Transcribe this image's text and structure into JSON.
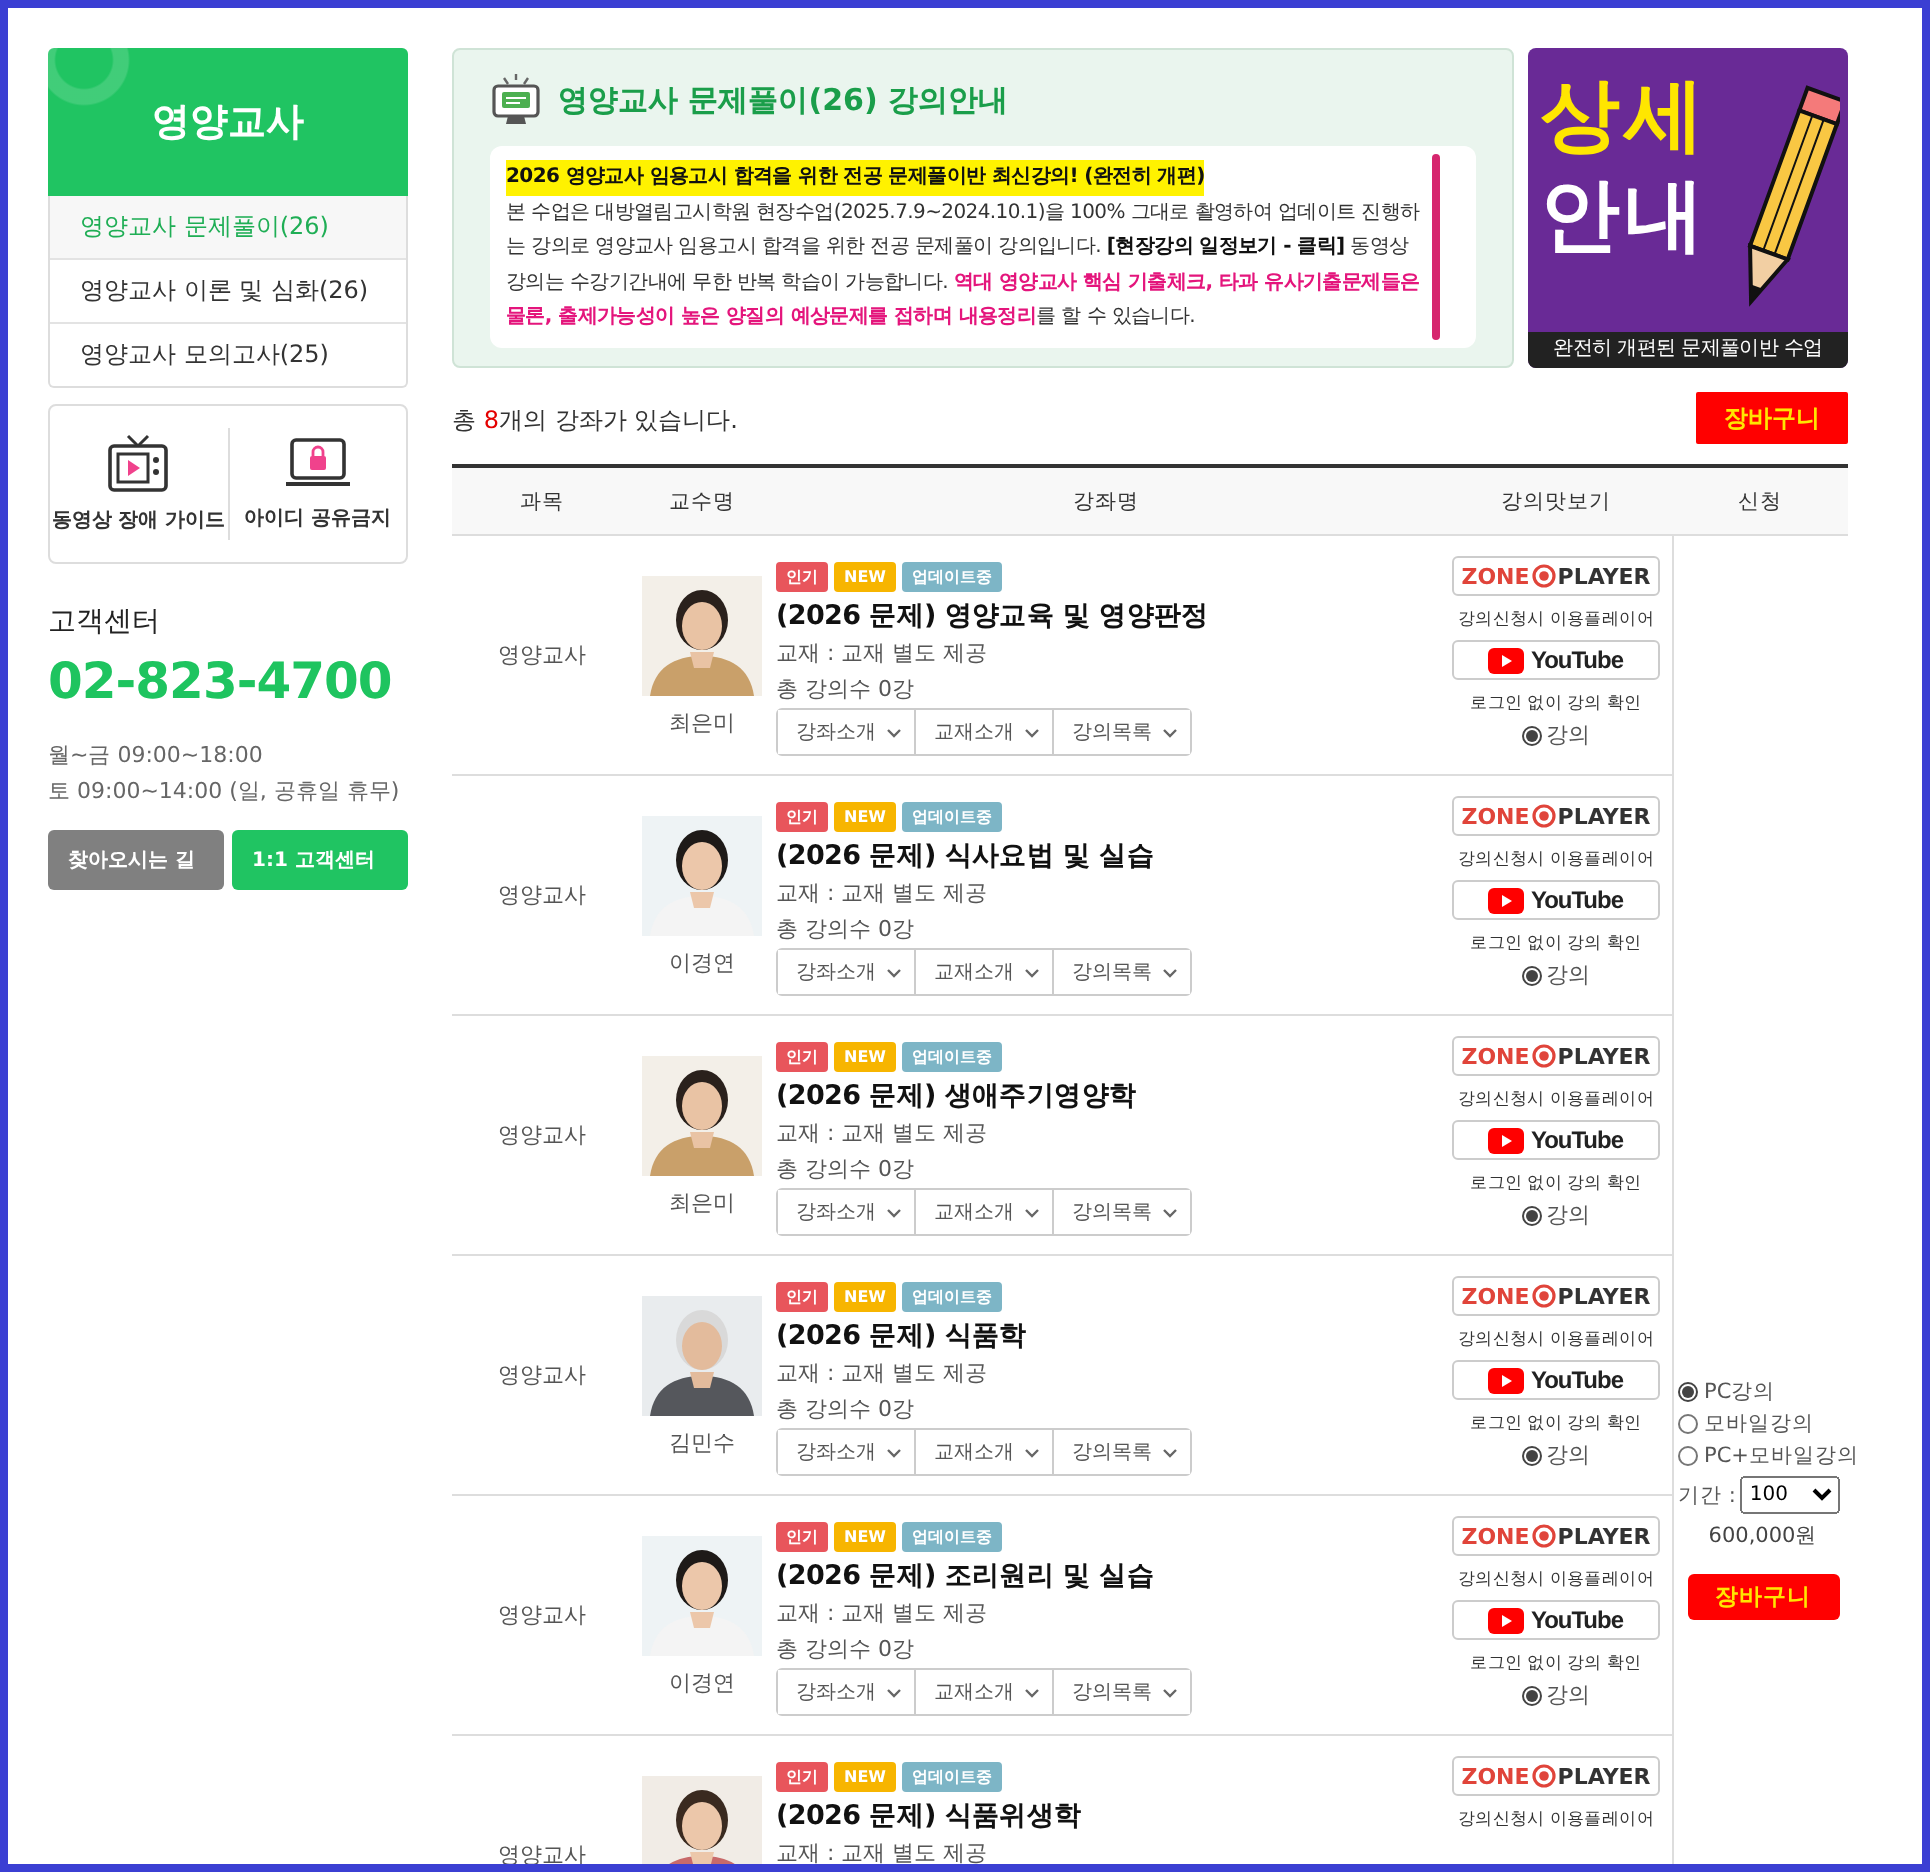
{
  "sidebar": {
    "title": "영양교사",
    "menu": [
      {
        "label": "영양교사 문제풀이(26)",
        "selected": true
      },
      {
        "label": "영양교사 이론 및 심화(26)",
        "selected": false
      },
      {
        "label": "영양교사 모의고사(25)",
        "selected": false
      }
    ],
    "tiles": [
      {
        "kind": "tv",
        "label": "동영상 장애 가이드"
      },
      {
        "kind": "laptop",
        "label": "아이디 공유금지"
      }
    ],
    "support": {
      "title": "고객센터",
      "phone": "02-823-4700",
      "hours": [
        "월~금 09:00~18:00",
        "토 09:00~14:00 (일, 공휴일 휴무)"
      ],
      "buttons": [
        {
          "label": "찾아오시는 길",
          "kind": "secondary"
        },
        {
          "label": "1:1 고객센터",
          "kind": "primary"
        }
      ]
    }
  },
  "info": {
    "title": "영양교사 문제풀이(26) 강의안내",
    "headline": "2026 영양교사 임용고시 합격을 위한 전공 문제풀이반 최신강의! (완전히 개편)",
    "body": [
      {
        "kind": "plain",
        "text": "본 수업은 대방열림고시학원 현장수업(2025.7.9~2024.10.1)을 100% 그대로 촬영하여 업데이트 진행하는 강의로 영양교사 임용고시 합격을 위한 전공 문제풀이 강의입니다. "
      },
      {
        "kind": "link",
        "text": "[현장강의 일정보기 - 클릭]"
      },
      {
        "kind": "plain",
        "text": " 동영상 강의는 수강기간내에 무한 반복 학습이 가능합니다. "
      },
      {
        "kind": "emphasis",
        "text": "역대 영양교사 핵심 기출체크, 타과 유사기출문제들은 물론, 출제가능성이 높은 양질의 예상문제를 접하며 내용정리"
      },
      {
        "kind": "plain",
        "text": "를 할 수 있습니다."
      }
    ]
  },
  "banner": {
    "line1": "상세",
    "line2": "안내",
    "caption": "완전히 개편된 문제풀이반 수업"
  },
  "count": {
    "before": "총 ",
    "number": "8",
    "after": "개의 강좌가 있습니다."
  },
  "cart_button": "장바구니",
  "table": {
    "columns": [
      "과목",
      "교수명",
      "강좌명",
      "강의맛보기",
      "신청"
    ],
    "rows": [
      {
        "subject": "영양교사",
        "professor": "최은미",
        "tags": [
          {
            "label": "인기",
            "color": "#e8555c"
          },
          {
            "label": "NEW",
            "color": "#f7b500"
          },
          {
            "label": "업데이트중",
            "color": "#7db5c6"
          }
        ],
        "title": "(2026 문제) 영양교육 및 영양판정",
        "material": "교재 : 교재 별도 제공",
        "lessons": "총 강의수 0강",
        "tabs": [
          "강좌소개",
          "교재소개",
          "강의목록"
        ],
        "zone": [
          "ZONE",
          "PLAYER"
        ],
        "zone_caption": "강의신청시 이용플레이어",
        "youtube": "YouTube",
        "youtube_caption": "로그인 없이 강의 확인",
        "lesson_option": {
          "label": "강의",
          "selected": true
        }
      },
      {
        "subject": "영양교사",
        "professor": "이경연",
        "tags": [
          {
            "label": "인기",
            "color": "#e8555c"
          },
          {
            "label": "NEW",
            "color": "#f7b500"
          },
          {
            "label": "업데이트중",
            "color": "#7db5c6"
          }
        ],
        "title": "(2026 문제) 식사요법 및 실습",
        "material": "교재 : 교재 별도 제공",
        "lessons": "총 강의수 0강",
        "tabs": [
          "강좌소개",
          "교재소개",
          "강의목록"
        ],
        "zone": [
          "ZONE",
          "PLAYER"
        ],
        "zone_caption": "강의신청시 이용플레이어",
        "youtube": "YouTube",
        "youtube_caption": "로그인 없이 강의 확인",
        "lesson_option": {
          "label": "강의",
          "selected": true
        }
      },
      {
        "subject": "영양교사",
        "professor": "최은미",
        "tags": [
          {
            "label": "인기",
            "color": "#e8555c"
          },
          {
            "label": "NEW",
            "color": "#f7b500"
          },
          {
            "label": "업데이트중",
            "color": "#7db5c6"
          }
        ],
        "title": "(2026 문제) 생애주기영양학",
        "material": "교재 : 교재 별도 제공",
        "lessons": "총 강의수 0강",
        "tabs": [
          "강좌소개",
          "교재소개",
          "강의목록"
        ],
        "zone": [
          "ZONE",
          "PLAYER"
        ],
        "zone_caption": "강의신청시 이용플레이어",
        "youtube": "YouTube",
        "youtube_caption": "로그인 없이 강의 확인",
        "lesson_option": {
          "label": "강의",
          "selected": true
        }
      },
      {
        "subject": "영양교사",
        "professor": "김민수",
        "tags": [
          {
            "label": "인기",
            "color": "#e8555c"
          },
          {
            "label": "NEW",
            "color": "#f7b500"
          },
          {
            "label": "업데이트중",
            "color": "#7db5c6"
          }
        ],
        "title": "(2026 문제) 식품학",
        "material": "교재 : 교재 별도 제공",
        "lessons": "총 강의수 0강",
        "tabs": [
          "강좌소개",
          "교재소개",
          "강의목록"
        ],
        "zone": [
          "ZONE",
          "PLAYER"
        ],
        "zone_caption": "강의신청시 이용플레이어",
        "youtube": "YouTube",
        "youtube_caption": "로그인 없이 강의 확인",
        "lesson_option": {
          "label": "강의",
          "selected": true
        }
      },
      {
        "subject": "영양교사",
        "professor": "이경연",
        "tags": [
          {
            "label": "인기",
            "color": "#e8555c"
          },
          {
            "label": "NEW",
            "color": "#f7b500"
          },
          {
            "label": "업데이트중",
            "color": "#7db5c6"
          }
        ],
        "title": "(2026 문제) 조리원리 및 실습",
        "material": "교재 : 교재 별도 제공",
        "lessons": "총 강의수 0강",
        "tabs": [
          "강좌소개",
          "교재소개",
          "강의목록"
        ],
        "zone": [
          "ZONE",
          "PLAYER"
        ],
        "zone_caption": "강의신청시 이용플레이어",
        "youtube": "YouTube",
        "youtube_caption": "로그인 없이 강의 확인",
        "lesson_option": {
          "label": "강의",
          "selected": true
        }
      },
      {
        "subject": "영양교사",
        "tags": [
          {
            "label": "인기",
            "color": "#e8555c"
          },
          {
            "label": "NEW",
            "color": "#f7b500"
          },
          {
            "label": "업데이트중",
            "color": "#7db5c6"
          }
        ],
        "title": "(2026 문제) 식품위생학",
        "material": "교재 : 교재 별도 제공",
        "zone": [
          "ZONE",
          "PLAYER"
        ],
        "zone_caption": "강의신청시 이용플레이어"
      }
    ]
  },
  "apply": {
    "options": [
      {
        "label": "PC강의",
        "selected": true
      },
      {
        "label": "모바일강의",
        "selected": false
      },
      {
        "label": "PC+모바일강의",
        "selected": false
      }
    ],
    "period_label": "기간 :",
    "period": "100",
    "price": "600,000원",
    "cart_button": "장바구니"
  }
}
